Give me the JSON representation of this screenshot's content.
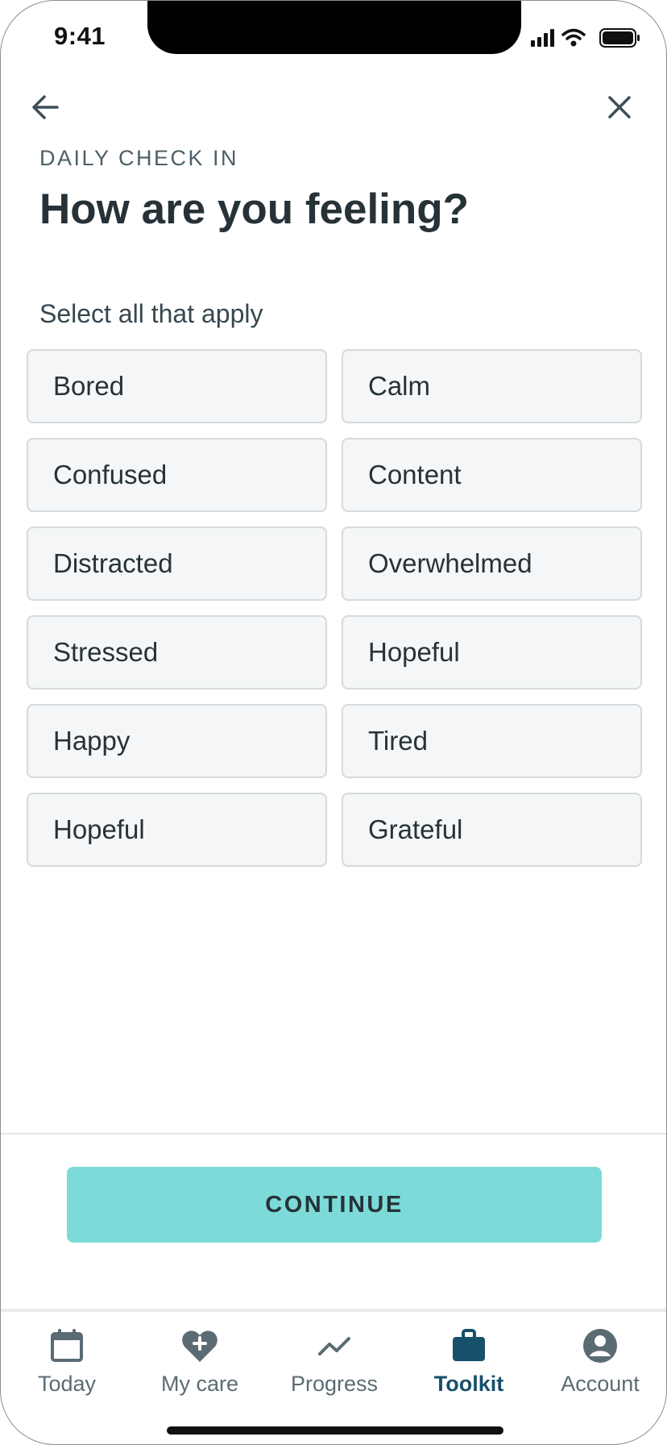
{
  "status_bar": {
    "time": "9:41"
  },
  "header": {
    "eyebrow": "DAILY CHECK IN",
    "title": "How are you feeling?",
    "instruction": "Select all that apply"
  },
  "options": [
    "Bored",
    "Calm",
    "Confused",
    "Content",
    "Distracted",
    "Overwhelmed",
    "Stressed",
    "Hopeful",
    "Happy",
    "Tired",
    "Hopeful",
    "Grateful"
  ],
  "continue_label": "CONTINUE",
  "tabs": [
    {
      "label": "Today",
      "icon": "calendar-icon",
      "active": false
    },
    {
      "label": "My care",
      "icon": "heart-plus-icon",
      "active": false
    },
    {
      "label": "Progress",
      "icon": "trend-icon",
      "active": false
    },
    {
      "label": "Toolkit",
      "icon": "briefcase-icon",
      "active": true
    },
    {
      "label": "Account",
      "icon": "user-icon",
      "active": false
    }
  ],
  "colors": {
    "accent": "#7cdbd8",
    "active_tab": "#17506b",
    "inactive_tab": "#5b6b73",
    "chip_bg": "#f4f6f7"
  }
}
